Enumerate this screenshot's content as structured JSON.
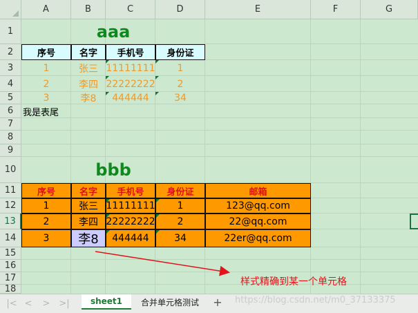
{
  "columns": [
    "A",
    "B",
    "C",
    "D",
    "E",
    "F",
    "G"
  ],
  "rows": [
    "1",
    "2",
    "3",
    "4",
    "5",
    "6",
    "7",
    "8",
    "9",
    "10",
    "11",
    "12",
    "13",
    "14",
    "15",
    "16",
    "17",
    "18"
  ],
  "table1": {
    "title": "aaa",
    "headers": [
      "序号",
      "名字",
      "手机号",
      "身份证"
    ],
    "rows": [
      [
        "1",
        "张三",
        "11111111",
        "1"
      ],
      [
        "2",
        "李四",
        "22222222",
        "2"
      ],
      [
        "3",
        "李8",
        "444444",
        "34"
      ]
    ]
  },
  "footer_text": "我是表尾",
  "table2": {
    "title": "bbb",
    "headers": [
      "序号",
      "名字",
      "手机号",
      "身份证",
      "邮箱"
    ],
    "rows": [
      [
        "1",
        "张三",
        "11111111",
        "1",
        "123@qq.com"
      ],
      [
        "2",
        "李四",
        "22222222",
        "2",
        "22@qq.com"
      ],
      [
        "3",
        "李8",
        "444444",
        "34",
        "22er@qq.com"
      ]
    ]
  },
  "annotation": "样式精确到某一个单元格",
  "sheet_tabs": [
    "sheet1",
    "合并单元格测试"
  ],
  "add_sheet": "+",
  "nav_buttons": [
    "|<",
    "<",
    ">",
    ">|"
  ],
  "watermark": "https://blog.csdn.net/m0_37133375",
  "colors": {
    "accent": "#1e7145",
    "title": "#0d8a1d",
    "orange": "#ff9900",
    "header_bg": "#d8fbfd",
    "header_red": "#d9130f",
    "arrow": "#e0141a"
  }
}
